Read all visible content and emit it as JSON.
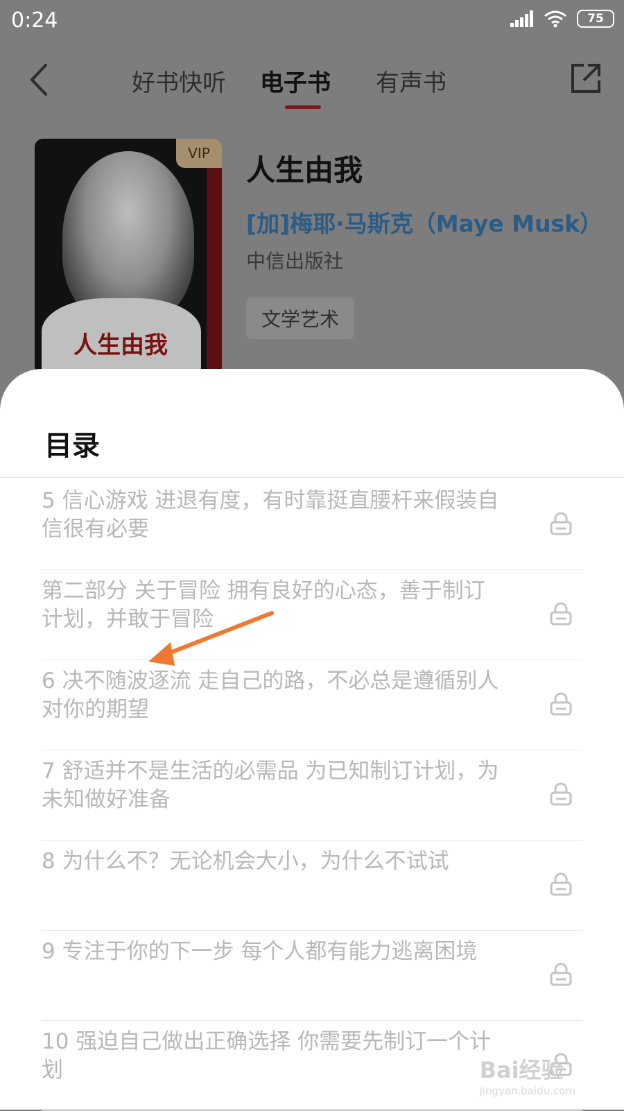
{
  "status_bar": {
    "time": "0:24",
    "battery": "75"
  },
  "nav": {
    "tabs": [
      {
        "label": "好书快听"
      },
      {
        "label": "电子书"
      },
      {
        "label": "有声书"
      }
    ]
  },
  "book": {
    "vip_badge": "VIP",
    "cover_title": "人生由我",
    "title": "人生由我",
    "author": "[加]梅耶·马斯克（Maye Musk）",
    "publisher": "中信出版社",
    "tag": "文学艺术"
  },
  "toc": {
    "title": "目录",
    "items": [
      {
        "text": "5 信心游戏 进退有度，有时靠挺直腰杆来假装自信很有必要"
      },
      {
        "text": "第二部分 关于冒险 拥有良好的心态，善于制订计划，并敢于冒险"
      },
      {
        "text": "6 决不随波逐流 走自己的路，不必总是遵循别人对你的期望"
      },
      {
        "text": "7 舒适并不是生活的必需品 为已知制订计划，为未知做好准备"
      },
      {
        "text": "8 为什么不？无论机会大小，为什么不试试"
      },
      {
        "text": "9 专注于你的下一步 每个人都有能力逃离困境"
      },
      {
        "text": "10 强迫自己做出正确选择 你需要先制订一个计划"
      }
    ]
  },
  "watermark": {
    "brand": "Bai经验",
    "url": "jingyan.baidu.com"
  },
  "colors": {
    "accent": "#7a1a1e",
    "author": "#2a5c86",
    "arrow": "#f07830"
  }
}
